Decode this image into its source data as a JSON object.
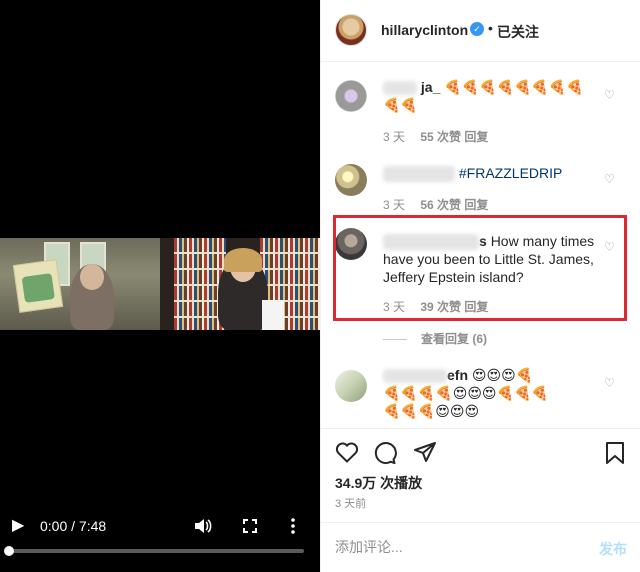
{
  "video": {
    "time_display": "0:00 / 7:48",
    "progress": 0.0,
    "icons": {
      "play": "play-icon",
      "volume": "volume-icon",
      "fullscreen": "fullscreen-icon",
      "more": "more-icon"
    }
  },
  "header": {
    "username": "hillaryclinton",
    "separator": "•",
    "follow_state": "已关注"
  },
  "comments": [
    {
      "username": "ja_",
      "text": "🍕🍕🍕🍕🍕🍕🍕🍕🍕🍕",
      "age": "3 天",
      "likes": "55 次赞",
      "reply": "回复"
    },
    {
      "text": "#FRAZZLEDRIP",
      "age": "3 天",
      "likes": "56 次赞",
      "reply": "回复"
    },
    {
      "username_tail": "s",
      "text": "How many times have you been to Little St. James, Jeffery Epstein island?",
      "age": "3 天",
      "likes": "39 次赞",
      "reply": "回复"
    },
    {
      "username_tail": "efn",
      "text_line1": "😍😍😍🍕",
      "text_line2": "🍕🍕🍕🍕😍😍😍🍕🍕🍕",
      "text_line3": "🍕🍕🍕😍😍😍"
    }
  ],
  "view_replies": "查看回复 (6)",
  "actions": {
    "views": "34.9万 次播放",
    "posted": "3 天前"
  },
  "add_comment": {
    "placeholder": "添加评论...",
    "post_label": "发布"
  },
  "colors": {
    "highlight": "#e0262e",
    "link": "#00376b",
    "verified": "#3897f0",
    "post_disabled": "#b2dffc"
  }
}
